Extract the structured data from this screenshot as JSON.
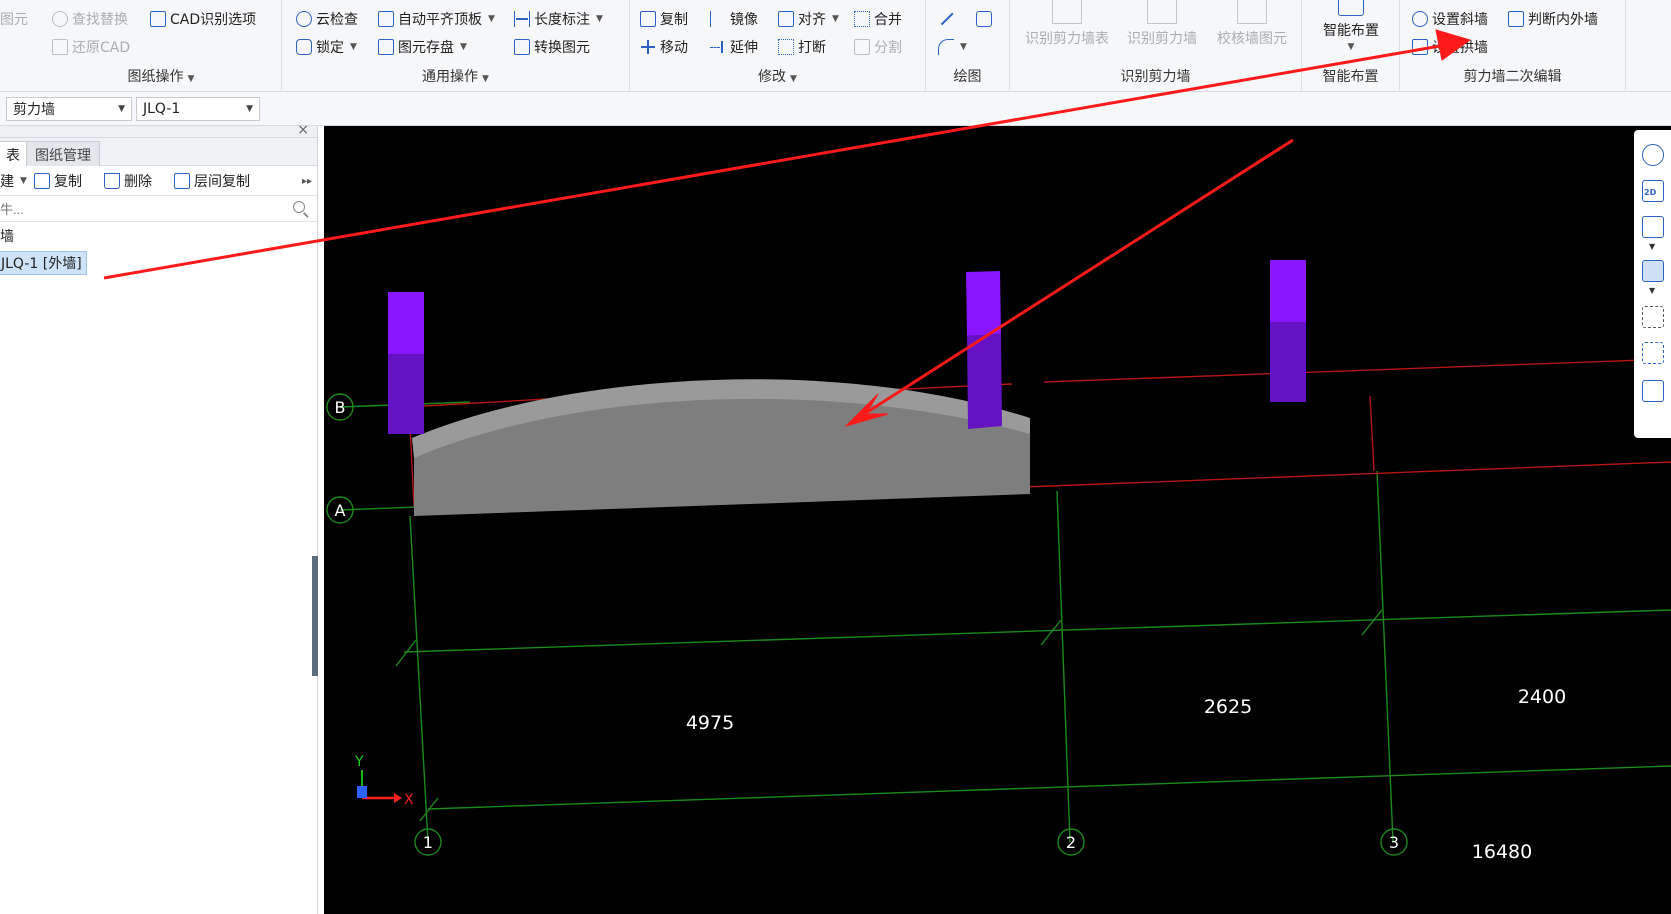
{
  "ribbon": {
    "groups": {
      "drawing_ops": {
        "label": "图纸操作",
        "partial_label": "图元",
        "find_replace": "查找替换",
        "cad_options": "CAD识别选项",
        "restore_cad": "还原CAD"
      },
      "general_ops": {
        "label": "通用操作",
        "cloud_check": "云检查",
        "auto_align_top": "自动平齐顶板",
        "length_dim": "长度标注",
        "lock": "锁定",
        "element_save": "图元存盘",
        "convert_element": "转换图元"
      },
      "modify": {
        "label": "修改",
        "copy": "复制",
        "mirror": "镜像",
        "align": "对齐",
        "merge": "合并",
        "move": "移动",
        "extend": "延伸",
        "break": "打断",
        "split": "分割"
      },
      "draw": {
        "label": "绘图"
      },
      "recognize_shear_wall": {
        "label": "识别剪力墙",
        "recognize_table": "识别剪力墙表",
        "recognize_wall": "识别剪力墙",
        "check_wall": "校核墙图元"
      },
      "smart_layout": {
        "label": "智能布置",
        "button": "智能布置"
      },
      "wall_secondary_edit": {
        "label": "剪力墙二次编辑",
        "set_sloped_wall": "设置斜墙",
        "judge_inner_outer": "判断内外墙",
        "set_arch_wall": "设置拱墙"
      }
    }
  },
  "selector_row": {
    "category": "剪力墙",
    "element": "JLQ-1"
  },
  "left_panel": {
    "tabs": [
      {
        "label": "表",
        "active": true
      },
      {
        "label": "图纸管理",
        "active": false
      }
    ],
    "tools": {
      "new_partial": "建",
      "copy": "复制",
      "delete": "删除",
      "floor_copy": "层间复制"
    },
    "search_placeholder": "牛...",
    "tree": {
      "parent": "墙",
      "child": "JLQ-1 [外墙]"
    }
  },
  "viewport": {
    "axes": {
      "rows": [
        "B",
        "A"
      ],
      "cols": [
        "1",
        "2",
        "3"
      ]
    },
    "dimensions": [
      "4975",
      "2625",
      "2400",
      "16480"
    ],
    "gizmo": {
      "y": "Y",
      "x": "X"
    }
  },
  "view_toolbar": {
    "label_2d": "2D"
  },
  "colors": {
    "viewport_bg": "#000000",
    "grid_green": "#1c8a1c",
    "grid_red": "#b81414",
    "column_purple": "#7a10e6",
    "wall_gray": "#7e7e7e",
    "annotation_arrow": "#ff1a1a",
    "accent": "#2b62c4"
  }
}
